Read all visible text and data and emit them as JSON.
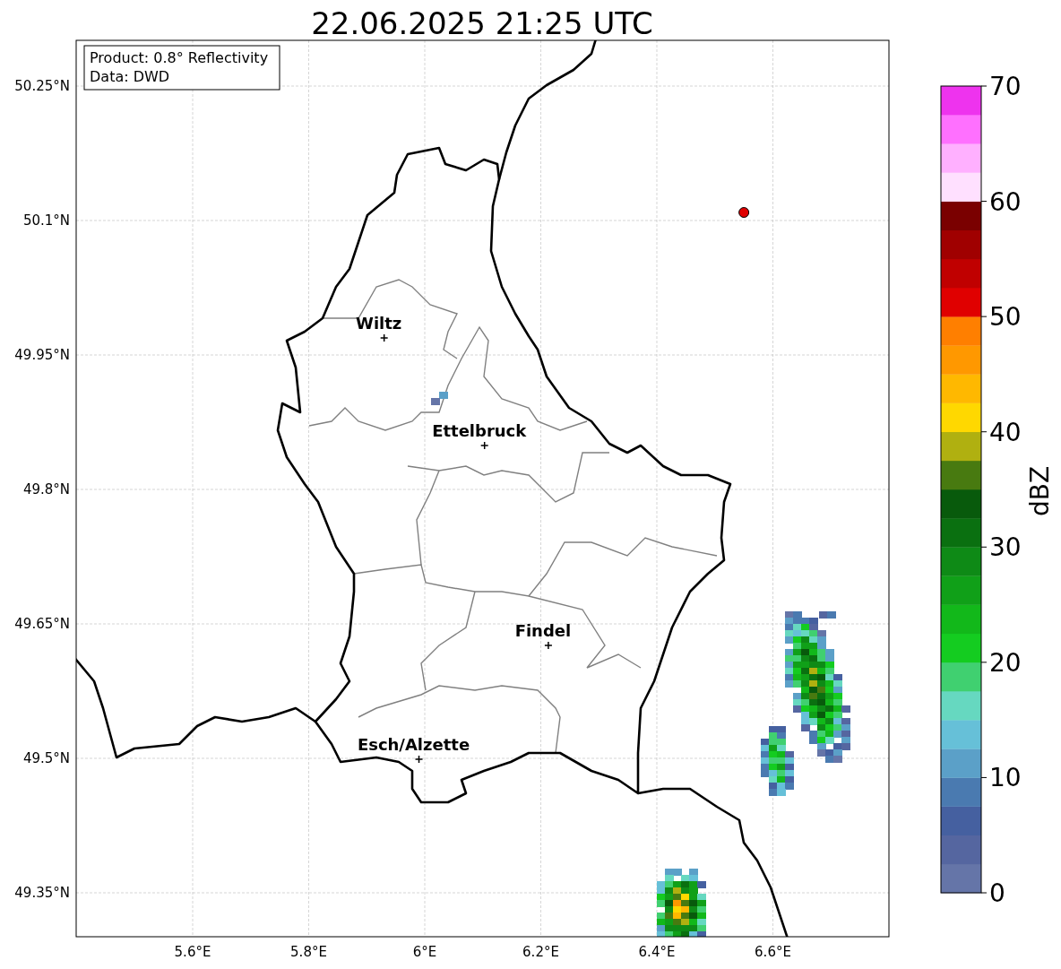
{
  "title": "22.06.2025 21:25 UTC",
  "info_box": [
    "Product: 0.8° Reflectivity",
    "Data: DWD"
  ],
  "map": {
    "lat_ticks": [
      "50.25°N",
      "50.1°N",
      "49.95°N",
      "49.8°N",
      "49.65°N",
      "49.5°N",
      "49.35°N"
    ],
    "lon_ticks": [
      "5.6°E",
      "5.8°E",
      "6°E",
      "6.2°E",
      "6.4°E",
      "6.6°E"
    ],
    "cities": [
      {
        "name": "Wiltz"
      },
      {
        "name": "Ettelbruck"
      },
      {
        "name": "Findel"
      },
      {
        "name": "Esch/Alzette"
      }
    ]
  },
  "colorbar": {
    "label": "dBZ",
    "ticks": [
      "70",
      "60",
      "50",
      "40",
      "30",
      "20",
      "10",
      "0"
    ],
    "segments": [
      {
        "color": "#6575a8"
      },
      {
        "color": "#5566a0"
      },
      {
        "color": "#4560a0"
      },
      {
        "color": "#4a7ab0"
      },
      {
        "color": "#5ba0c8"
      },
      {
        "color": "#66c0d8"
      },
      {
        "color": "#66d8c0"
      },
      {
        "color": "#40d070"
      },
      {
        "color": "#14cc20"
      },
      {
        "color": "#12b81a"
      },
      {
        "color": "#10a018"
      },
      {
        "color": "#0e8a16"
      },
      {
        "color": "#0a7010"
      },
      {
        "color": "#085a0c"
      },
      {
        "color": "#487a10"
      },
      {
        "color": "#b0b010"
      },
      {
        "color": "#ffd800"
      },
      {
        "color": "#ffb800"
      },
      {
        "color": "#ff9800"
      },
      {
        "color": "#ff7f00"
      },
      {
        "color": "#e00000"
      },
      {
        "color": "#c00000"
      },
      {
        "color": "#a00000"
      },
      {
        "color": "#7a0000"
      },
      {
        "color": "#ffe0ff"
      },
      {
        "color": "#ffb0ff"
      },
      {
        "color": "#ff70ff"
      },
      {
        "color": "#ee33ee"
      }
    ]
  }
}
